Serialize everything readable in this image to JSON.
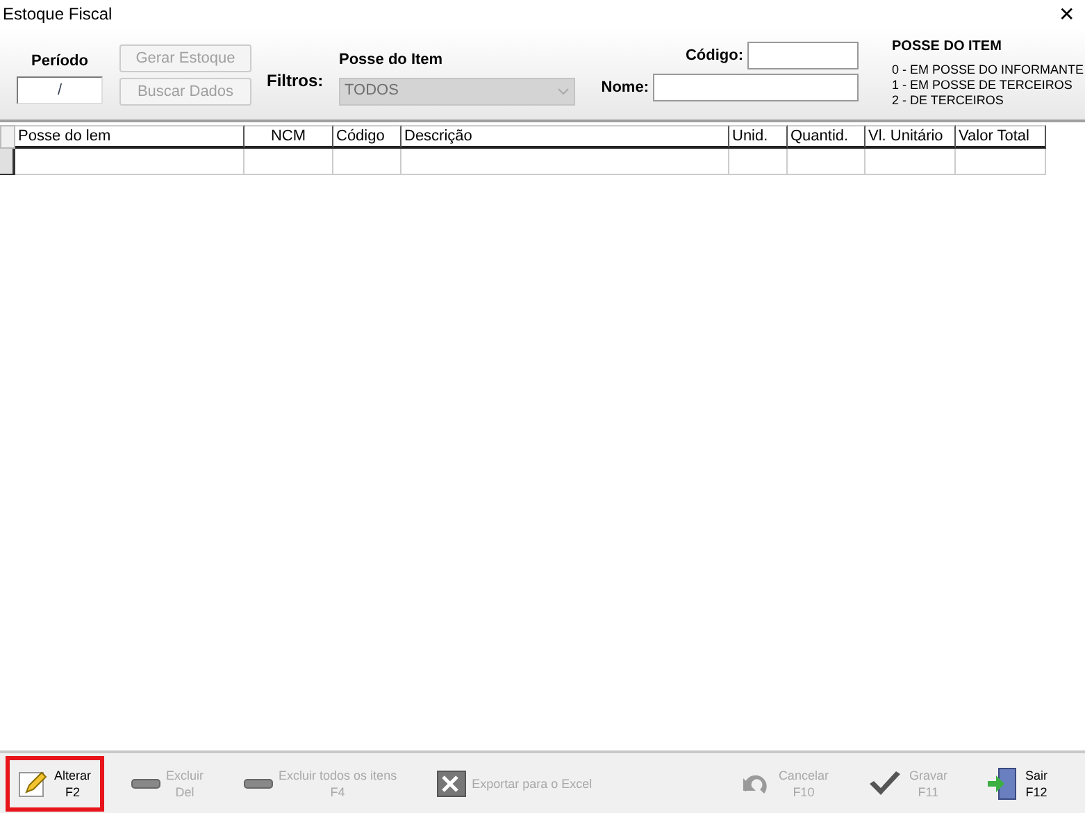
{
  "window": {
    "title": "Estoque Fiscal",
    "close": "✕"
  },
  "header": {
    "periodo_label": "Período",
    "periodo_value": "/",
    "buttons": [
      {
        "label": "Gerar Estoque",
        "disabled": true
      },
      {
        "label": "Buscar Dados",
        "disabled": true
      }
    ],
    "filtros_label": "Filtros:",
    "posse_label": "Posse do Item",
    "posse_value": "TODOS",
    "posse_disabled": true,
    "codigo_label": "Código:",
    "nome_label": "Nome:",
    "legend": {
      "title": "POSSE DO ITEM",
      "lines": [
        "0 - EM POSSE DO INFORMANTE",
        "1 - EM POSSE DE TERCEIROS",
        "2 - DE TERCEIROS"
      ]
    }
  },
  "table": {
    "columns": [
      "Posse do lem",
      "NCM",
      "Código",
      "Descrição",
      "Unid.",
      "Quantid.",
      "Vl. Unitário",
      "Valor Total"
    ]
  },
  "toolbar": [
    {
      "kind": "pencil",
      "label": "Alterar",
      "key": "F2",
      "disabled": false,
      "highlighted": true
    },
    {
      "kind": "minus",
      "label": "Excluir",
      "key": "Del",
      "disabled": true,
      "highlighted": false
    },
    {
      "kind": "minus",
      "label": "Excluir todos os itens",
      "key": "F4",
      "disabled": true,
      "highlighted": false
    },
    {
      "kind": "excel",
      "label": "Exportar para o Excel",
      "disabled": true,
      "highlighted": false
    },
    {
      "kind": "undo",
      "label": "Cancelar",
      "key": "F10",
      "disabled": true,
      "highlighted": false
    },
    {
      "kind": "check",
      "label": "Gravar",
      "key": "F11",
      "disabled": true,
      "highlighted": false
    },
    {
      "kind": "exit",
      "label": "Sair",
      "key": "F12",
      "disabled": false,
      "highlighted": false
    }
  ]
}
